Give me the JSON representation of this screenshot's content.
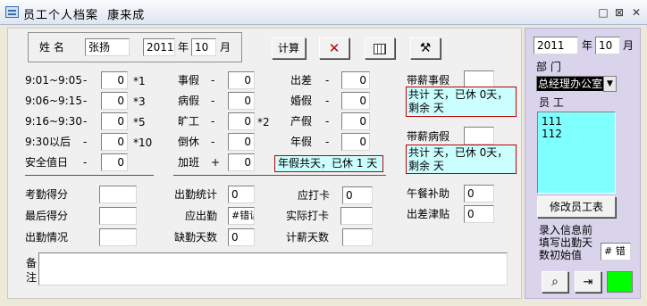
{
  "window": {
    "title": "员工个人档案  康来成",
    "controls": [
      "□",
      "⊠",
      "✕"
    ]
  },
  "top": {
    "name_label": "姓 名",
    "name_value": "张扬",
    "year_value": "2011",
    "year_unit": "年",
    "month_value": "10",
    "month_unit": "月",
    "calc_label": "计算"
  },
  "late": [
    {
      "label": "9:01~9:05",
      "dash": "-",
      "value": "0",
      "mult": "*1"
    },
    {
      "label": "9:06~9:15",
      "dash": "-",
      "value": "0",
      "mult": "*3"
    },
    {
      "label": "9:16~9:30",
      "dash": "-",
      "value": "0",
      "mult": "*5"
    },
    {
      "label": "9:30以后",
      "dash": "-",
      "value": "0",
      "mult": "*10"
    },
    {
      "label": "安全值日",
      "dash": "-",
      "value": "0",
      "mult": ""
    }
  ],
  "leave": [
    {
      "label": "事假",
      "dash": "-",
      "value": "0",
      "mult": ""
    },
    {
      "label": "病假",
      "dash": "-",
      "value": "0",
      "mult": ""
    },
    {
      "label": "旷工",
      "dash": "-",
      "value": "0",
      "mult": "*2"
    },
    {
      "label": "倒休",
      "dash": "-",
      "value": "0",
      "mult": ""
    },
    {
      "label": "加班",
      "dash": "+",
      "value": "0",
      "mult": ""
    }
  ],
  "other": [
    {
      "label": "出差",
      "dash": "-",
      "value": "0"
    },
    {
      "label": "婚假",
      "dash": "-",
      "value": "0"
    },
    {
      "label": "产假",
      "dash": "-",
      "value": "0"
    },
    {
      "label": "年假",
      "dash": "-",
      "value": "0"
    }
  ],
  "annual_summary": "年假共天，已休 1 天",
  "paid_personal": {
    "label": "带薪事假",
    "value": "",
    "summary_line1": "共计 天，已休 0天，",
    "summary_line2": "剩余  天"
  },
  "paid_sick": {
    "label": "带薪病假",
    "value": "",
    "summary_line1": "共计 天，已休 0天，",
    "summary_line2": "剩余  天"
  },
  "scores": {
    "assess_label": "考勤得分",
    "assess_value": "",
    "final_label": "最后得分",
    "final_value": "",
    "status_label": "出勤情况",
    "status_value": ""
  },
  "stats": {
    "att_stat_label": "出勤统计",
    "att_stat_value": "0",
    "due_label": "应出勤",
    "due_value": "#错误",
    "absent_label": "缺勤天数",
    "absent_value": "0"
  },
  "cards": {
    "due_card_label": "应打卡",
    "due_card_value": "0",
    "actual_card_label": "实际打卡",
    "actual_card_value": "",
    "pay_days_label": "计薪天数",
    "pay_days_value": ""
  },
  "allow": {
    "lunch_label": "午餐补助",
    "lunch_value": "0",
    "trip_label": "出差津贴",
    "trip_value": "0"
  },
  "remark": {
    "label_1": "备",
    "label_2": "注",
    "value": ""
  },
  "side": {
    "year": "2011",
    "year_unit": "年",
    "month": "10",
    "month_unit": "月",
    "dept_label": "部  门",
    "dept_value": "总经理办公室",
    "staff_label": "员  工",
    "staff": [
      "111",
      "112"
    ],
    "modify_btn": "修改员工表",
    "note_1": "录入信息前",
    "note_2": "填写出勤天",
    "note_3": "数初始值",
    "init_value": "# 错"
  },
  "colors": {
    "cyan": "#ccffff",
    "red_border": "#c00000",
    "green": "#00ff00",
    "side_bg": "#d9d4ec"
  }
}
